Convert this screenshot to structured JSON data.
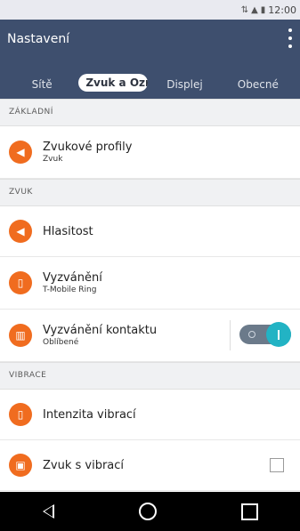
{
  "status": {
    "time": "12:00"
  },
  "appbar": {
    "title": "Nastavení"
  },
  "tabs": [
    {
      "label": "Sítě"
    },
    {
      "label": "Zvuk a Oznámení"
    },
    {
      "label": "Displej"
    },
    {
      "label": "Obecné"
    }
  ],
  "sections": [
    {
      "title": "ZÁKLADNÍ"
    },
    {
      "title": "ZVUK"
    },
    {
      "title": "VIBRACE"
    }
  ],
  "items": [
    {
      "title": "Zvukové profily",
      "subtitle": "Zvuk",
      "icon": "speaker-icon"
    },
    {
      "title": "Hlasitost",
      "subtitle": "",
      "icon": "speaker-icon"
    },
    {
      "title": "Vyzvánění",
      "subtitle": "T-Mobile Ring",
      "icon": "phone-icon"
    },
    {
      "title": "Vyzvánění kontaktu",
      "subtitle": "Oblíbené",
      "icon": "piano-icon",
      "toggle": "on"
    },
    {
      "title": "Intenzita vibrací",
      "subtitle": "",
      "icon": "vibrate-icon"
    },
    {
      "title": "Zvuk s vibrací",
      "subtitle": "",
      "icon": "vibrate-phone-icon",
      "checkbox": "unchecked"
    }
  ],
  "colors": {
    "appbar": "#3e4f6e",
    "accent": "#f06c1f",
    "toggle_on": "#22b3c4"
  }
}
